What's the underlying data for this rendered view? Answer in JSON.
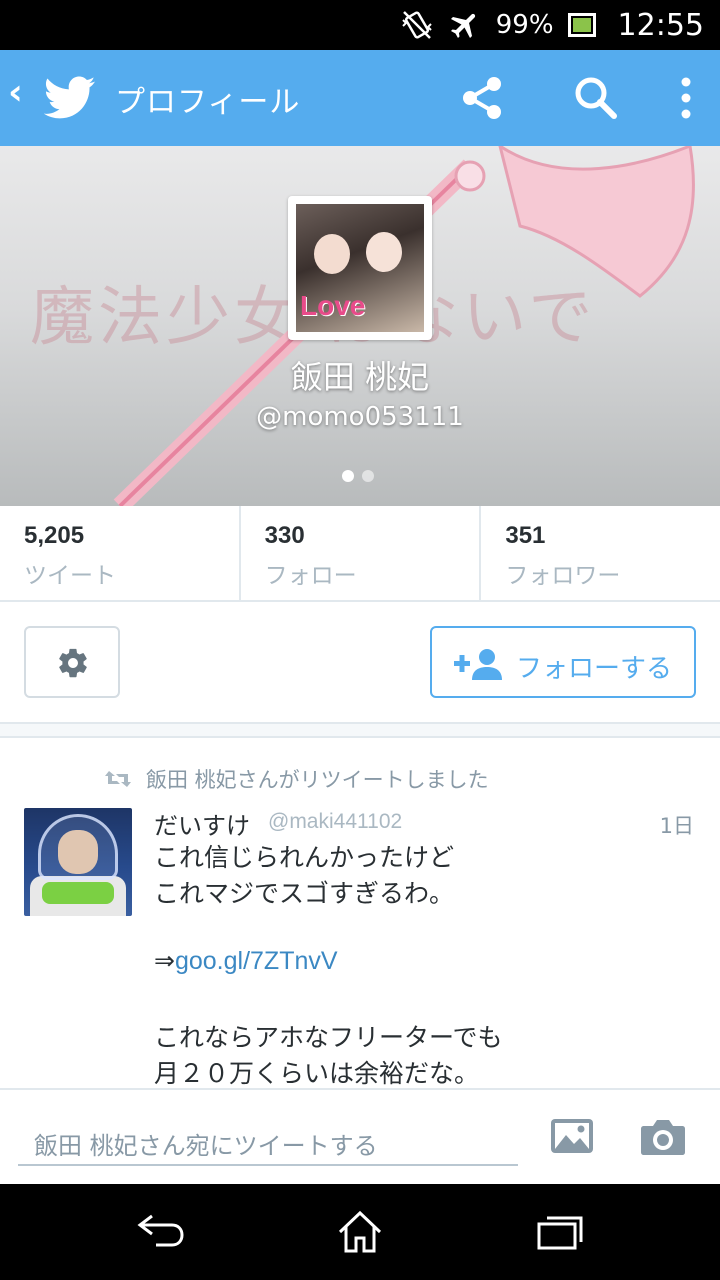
{
  "status_bar": {
    "battery_percent": "99%",
    "time": "12:55",
    "icons": [
      "vibrate-icon",
      "airplane-icon",
      "battery-icon"
    ]
  },
  "app_bar": {
    "back_glyph": "‹",
    "title": "プロフィール",
    "icons": [
      "twitter-bird-icon",
      "share-icon",
      "search-icon",
      "overflow-menu-icon"
    ]
  },
  "profile": {
    "banner_text": "魔法少女  ばないで",
    "avatar_text": "Love",
    "display_name": "飯田 桃妃",
    "handle": "@momo053111",
    "page_count": 2,
    "active_page": 1
  },
  "stats": [
    {
      "value": "5,205",
      "label": "ツイート"
    },
    {
      "value": "330",
      "label": "フォロー"
    },
    {
      "value": "351",
      "label": "フォロワー"
    }
  ],
  "actions": {
    "follow_label": "フォローする"
  },
  "tweet": {
    "retweet_notice": "飯田 桃妃さんがリツイートしました",
    "author_name": "だいすけ",
    "author_handle": "@maki441102",
    "time": "1日",
    "lines": [
      "これ信じられんかったけど",
      "これマジでスゴすぎるわ。",
      "",
      "",
      "これならアホなフリーターでも",
      "月２０万くらいは余裕だな。"
    ],
    "link_prefix": "⇒",
    "link_text": "goo.gl/7ZTnvV"
  },
  "compose": {
    "placeholder": "飯田 桃妃さん宛にツイートする"
  },
  "colors": {
    "brand": "#55acee",
    "link": "#3b88c3",
    "muted": "#aab8c2"
  }
}
